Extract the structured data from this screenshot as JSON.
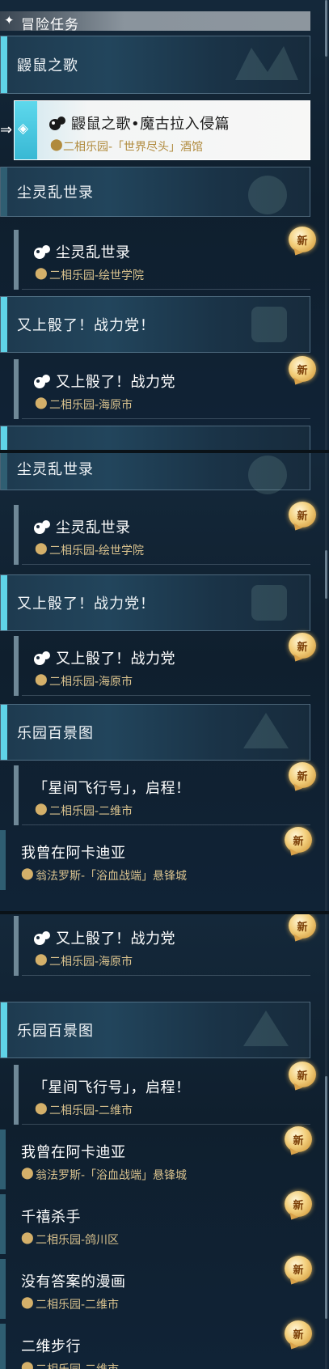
{
  "header": {
    "icon": "sparkle-diamond-icon",
    "title": "冒险任务"
  },
  "badge_label": "新",
  "colors": {
    "accent": "#5fd3e8",
    "location": "#d9c28e",
    "badge": "#f3cf7c"
  },
  "panel1": {
    "cat_mole": "鼹鼠之歌",
    "selected": {
      "title": "鼹鼠之歌•魔古拉入侵篇",
      "location": "二相乐园-「世界尽头」酒馆"
    },
    "cat_dust": "尘灵乱世录",
    "item_dust": {
      "title": "尘灵乱世录",
      "location": "二相乐园-绘世学院"
    },
    "cat_dice": "又上骰了！战力党！",
    "item_dice": {
      "title": "又上骰了！战力党",
      "location": "二相乐园-海原市"
    }
  },
  "panel2": {
    "cat_dust": "尘灵乱世录",
    "item_dust": {
      "title": "尘灵乱世录",
      "location": "二相乐园-绘世学院"
    },
    "cat_dice": "又上骰了！战力党！",
    "item_dice": {
      "title": "又上骰了！战力党",
      "location": "二相乐园-海原市"
    },
    "cat_park": "乐园百景图",
    "item_star": {
      "title": "「星间飞行号」，启程！",
      "location": "二相乐园-二维市"
    },
    "item_arc": {
      "title": "我曾在阿卡迪亚",
      "location": "翁法罗斯-「浴血战端」悬锋城"
    }
  },
  "panel3": {
    "item_dice": {
      "title": "又上骰了！战力党",
      "location": "二相乐园-海原市"
    },
    "cat_park": "乐园百景图",
    "item_star": {
      "title": "「星间飞行号」，启程！",
      "location": "二相乐园-二维市"
    },
    "item_arc": {
      "title": "我曾在阿卡迪亚",
      "location": "翁法罗斯-「浴血战端」悬锋城"
    },
    "item_killer": {
      "title": "千禧杀手",
      "location": "二相乐园-鸽川区"
    },
    "item_comic": {
      "title": "没有答案的漫画",
      "location": "二相乐园-二维市"
    },
    "item_walk": {
      "title": "二维步行",
      "location": "二相乐园-二维市"
    }
  }
}
